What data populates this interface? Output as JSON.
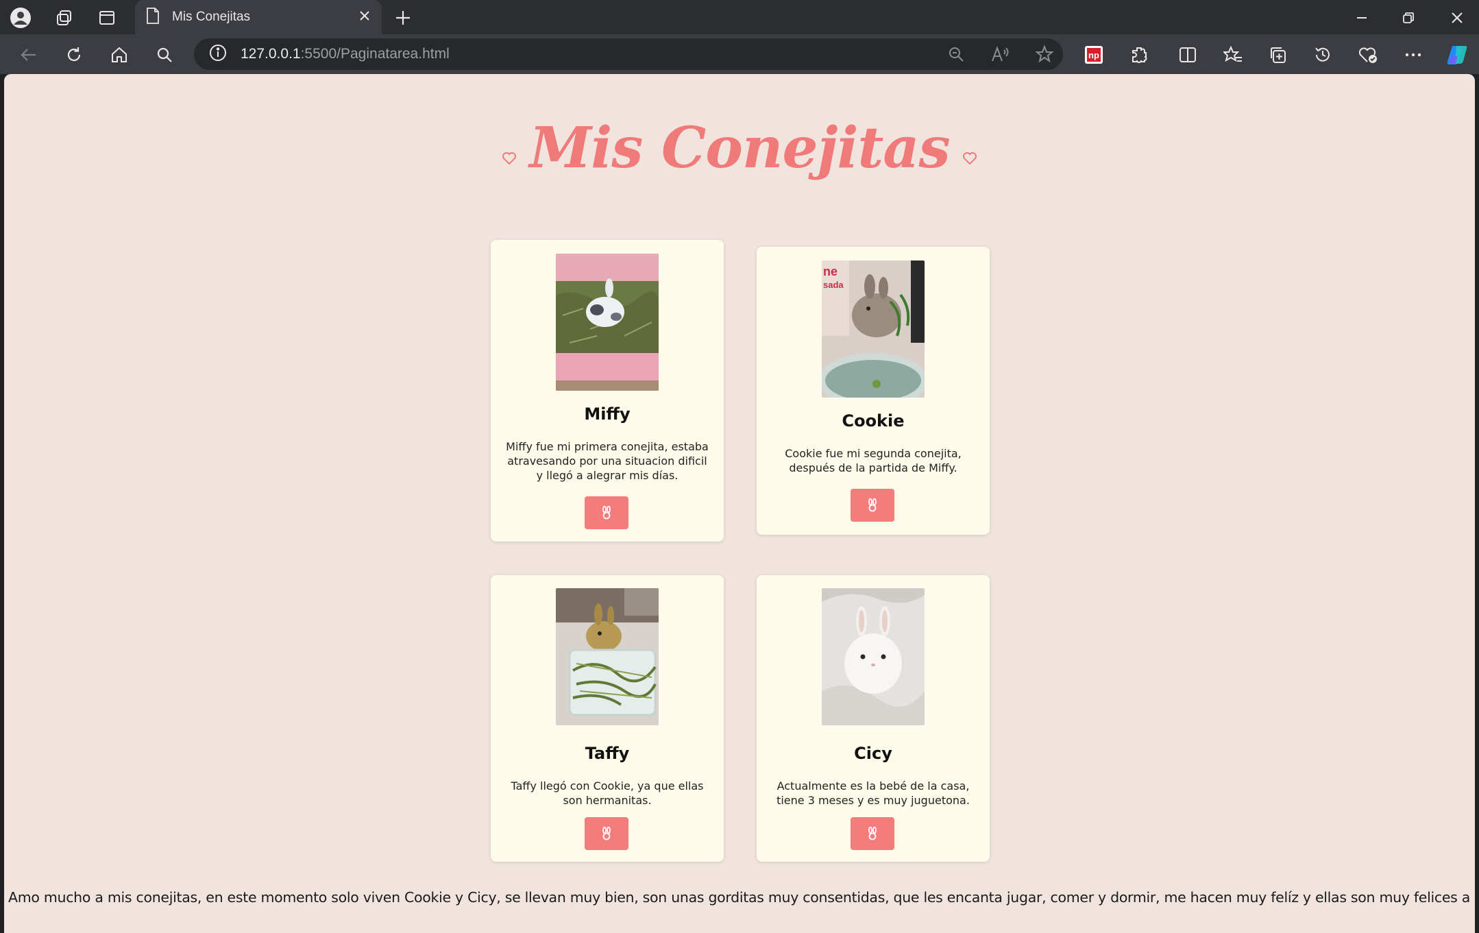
{
  "browser": {
    "tab_title": "Mis Conejitas",
    "url_host": "127.0.0.1",
    "url_path": ":5500/Paginatarea.html",
    "icons": [
      "profile-icon",
      "workspaces-icon",
      "tab-actions-icon",
      "page-icon",
      "close-tab-icon",
      "new-tab-icon",
      "minimize-icon",
      "restore-icon",
      "close-window-icon",
      "back-icon",
      "refresh-icon",
      "home-icon",
      "search-icon",
      "site-info-icon",
      "zoom-out-icon",
      "read-aloud-icon",
      "favorite-star-icon",
      "np-extension-icon",
      "extensions-icon",
      "split-screen-icon",
      "favorites-icon",
      "collections-icon",
      "history-icon",
      "browser-essentials-icon",
      "more-icon",
      "copilot-icon"
    ]
  },
  "page": {
    "title": "Mis Conejitas",
    "accent_color": "#f07a7a",
    "background_color": "#f1e4df",
    "card_color": "#fefbea",
    "button_color": "#f57c7c",
    "button_icon": "bunny-icon",
    "cards": [
      {
        "name": "Miffy",
        "description": "Miffy fue mi primera conejita, estaba atravesando por una situacion dificil y llegó a alegrar mis días."
      },
      {
        "name": "Cookie",
        "description": "Cookie fue mi segunda conejita, después de la partida de Miffy."
      },
      {
        "name": "Taffy",
        "description": "Taffy llegó con Cookie, ya que ellas son hermanitas."
      },
      {
        "name": "Cicy",
        "description": "Actualmente es la bebé de la casa, tiene 3 meses y es muy juguetona."
      }
    ],
    "footer": "Amo mucho a mis conejitas, en este momento solo viven Cookie y Cicy, se llevan muy bien, son unas gorditas muy consentidas, que les encanta jugar, comer y dormir, me hacen muy felíz y ellas son muy felices a mi lado."
  }
}
